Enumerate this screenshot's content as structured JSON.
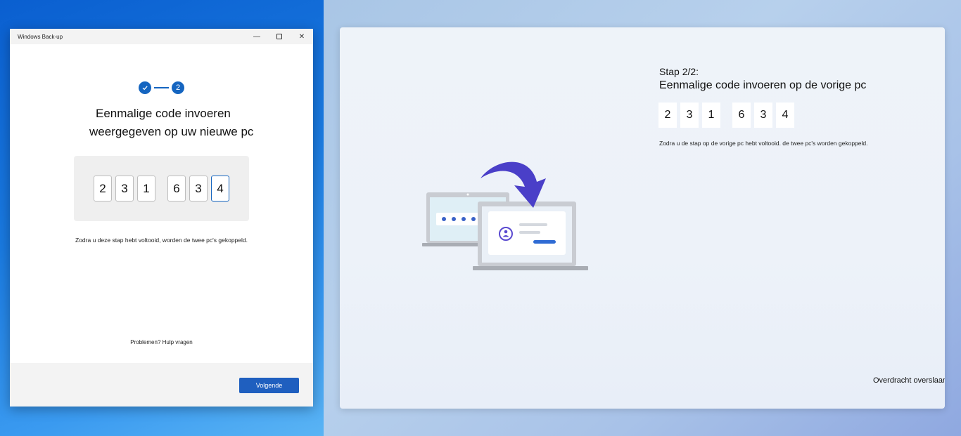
{
  "window": {
    "title": "Windows Back-up",
    "minimize_glyph": "—",
    "close_glyph": "✕",
    "stepper": {
      "current_step": "2"
    },
    "heading_line1": "Eenmalige code invoeren",
    "heading_line2": "weergegeven op uw nieuwe pc",
    "code_digits": [
      "2",
      "3",
      "1",
      "6",
      "3",
      "4"
    ],
    "info": "Zodra u deze stap hebt voltooid, worden de twee pc's gekoppeld.",
    "help_link": "Problemen? Hulp vragen",
    "next_button": "Volgende"
  },
  "panel": {
    "step_label": "Stap 2/2:",
    "title": "Eenmalige code invoeren op de vorige pc",
    "code_digits": [
      "2",
      "3",
      "1",
      "6",
      "3",
      "4"
    ],
    "info": "Zodra u de stap op de vorige pc  hebt voltooid. de twee pc's worden gekoppeld.",
    "skip_link": "Overdracht overslaan"
  },
  "colors": {
    "accent": "#1565c0",
    "button": "#1f5fbf",
    "arrow": "#4a3fc8"
  },
  "icons": [
    "checkmark-icon",
    "minimize-icon",
    "maximize-icon",
    "close-icon",
    "laptop-transfer-illustration",
    "user-icon"
  ]
}
